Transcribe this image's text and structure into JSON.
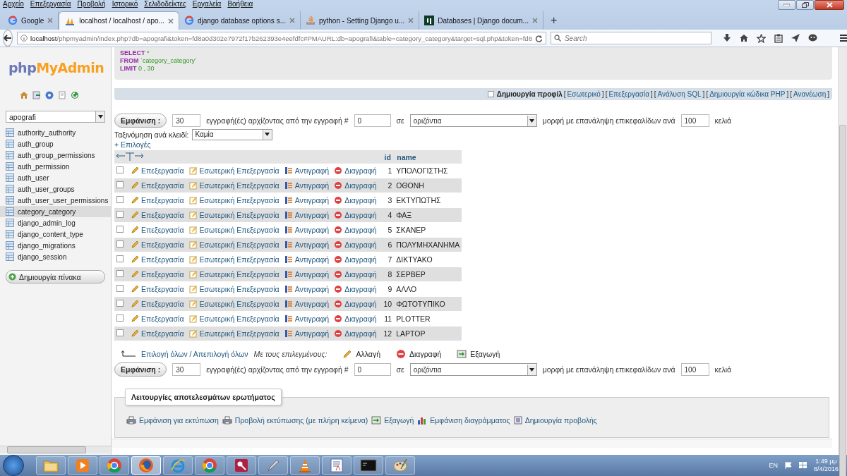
{
  "menu": [
    "Αρχείο",
    "Επεξεργασία",
    "Προβολή",
    "Ιστορικό",
    "Σελιδοδείκτες",
    "Εργαλεία",
    "Βοήθεια"
  ],
  "tabs": [
    {
      "kind": "google",
      "title": "Google",
      "selected": false
    },
    {
      "kind": "pma",
      "title": "localhost / localhost / apo...",
      "selected": true
    },
    {
      "kind": "google",
      "title": "django database options s...",
      "selected": false
    },
    {
      "kind": "so",
      "title": "python - Setting Django u...",
      "selected": false
    },
    {
      "kind": "dj",
      "title": "Databases | Django docum...",
      "selected": false
    }
  ],
  "new_tab": "+",
  "address": {
    "host": "localhost",
    "path": "/phpmyadmin/index.php?db=apografi&token=fd8a0d302e7972f17b262393e4eefdfc#PMAURL:db=apografi&table=category_category&target=sql.php&token=fd8"
  },
  "search": {
    "placeholder": "Search"
  },
  "sidebar": {
    "logo_a": "php",
    "logo_b": "MyAdmin",
    "database": "apografi",
    "tables": [
      {
        "name": "authority_authority",
        "selected": false
      },
      {
        "name": "auth_group",
        "selected": false
      },
      {
        "name": "auth_group_permissions",
        "selected": false
      },
      {
        "name": "auth_permission",
        "selected": false
      },
      {
        "name": "auth_user",
        "selected": false
      },
      {
        "name": "auth_user_groups",
        "selected": false
      },
      {
        "name": "auth_user_user_permissions",
        "selected": false
      },
      {
        "name": "category_category",
        "selected": true
      },
      {
        "name": "django_admin_log",
        "selected": false
      },
      {
        "name": "django_content_type",
        "selected": false
      },
      {
        "name": "django_migrations",
        "selected": false
      },
      {
        "name": "django_session",
        "selected": false
      }
    ],
    "create_button": "Δημιουργία πίνακα"
  },
  "sql": [
    {
      "keyword": "SELECT",
      "value": "*"
    },
    {
      "keyword": "FROM",
      "value": "`category_category`"
    },
    {
      "keyword": "LIMIT",
      "value": "0 , 30"
    }
  ],
  "profiling": {
    "checked": false,
    "label": "Δημιουργία προφίλ",
    "bracket_open": "[",
    "bracket_close": "]",
    "links": [
      "Εσωτερικό",
      "Επεξεργασία",
      "Ανάλυση SQL",
      "Δημιουργία κώδικα PHP",
      "Ανανέωση"
    ]
  },
  "navigators": [
    {
      "button": "Εμφάνιση :",
      "count": "30",
      "text_a": "εγγραφή(ές) αρχίζοντας από την εγγραφή #",
      "start": "0",
      "text_b": "σε",
      "mode": "οριζόντια",
      "text_c": "μορφή με επανάληψη επικεφαλίδων ανά",
      "repeat": "100",
      "text_d": "κελιά"
    },
    {
      "button": "Εμφάνιση :",
      "count": "30",
      "text_a": "εγγραφή(ές) αρχίζοντας από την εγγραφή #",
      "start": "0",
      "text_b": "σε",
      "mode": "οριζόντια",
      "text_c": "μορφή με επανάληψη επικεφαλίδων ανά",
      "repeat": "100",
      "text_d": "κελιά"
    }
  ],
  "sort": {
    "label": "Ταξινόμηση ανά κλειδί:",
    "value": "Καμία"
  },
  "options_link": "+ Επιλογές",
  "table": {
    "columns": [
      "id",
      "name"
    ],
    "rows": [
      {
        "checked": false,
        "actions": [
          "Επεξεργασία",
          "Εσωτερική Επεξεργασία",
          "Αντιγραφή",
          "Διαγραφή"
        ],
        "id": "1",
        "name": "ΥΠΟΛΟΓΙΣΤΗΣ"
      },
      {
        "checked": false,
        "actions": [
          "Επεξεργασία",
          "Εσωτερική Επεξεργασία",
          "Αντιγραφή",
          "Διαγραφή"
        ],
        "id": "2",
        "name": "ΟΘΟΝΗ"
      },
      {
        "checked": false,
        "actions": [
          "Επεξεργασία",
          "Εσωτερική Επεξεργασία",
          "Αντιγραφή",
          "Διαγραφή"
        ],
        "id": "3",
        "name": "ΕΚΤΥΠΩΤΗΣ"
      },
      {
        "checked": false,
        "actions": [
          "Επεξεργασία",
          "Εσωτερική Επεξεργασία",
          "Αντιγραφή",
          "Διαγραφή"
        ],
        "id": "4",
        "name": "ΦΑΞ"
      },
      {
        "checked": false,
        "actions": [
          "Επεξεργασία",
          "Εσωτερική Επεξεργασία",
          "Αντιγραφή",
          "Διαγραφή"
        ],
        "id": "5",
        "name": "ΣΚΑΝΕΡ"
      },
      {
        "checked": false,
        "actions": [
          "Επεξεργασία",
          "Εσωτερική Επεξεργασία",
          "Αντιγραφή",
          "Διαγραφή"
        ],
        "id": "6",
        "name": "ΠΟΛΥΜΗΧΑΝΗΜΑ"
      },
      {
        "checked": false,
        "actions": [
          "Επεξεργασία",
          "Εσωτερική Επεξεργασία",
          "Αντιγραφή",
          "Διαγραφή"
        ],
        "id": "7",
        "name": "ΔΙΚΤΥΑΚΟ"
      },
      {
        "checked": false,
        "actions": [
          "Επεξεργασία",
          "Εσωτερική Επεξεργασία",
          "Αντιγραφή",
          "Διαγραφή"
        ],
        "id": "8",
        "name": "ΣΕΡΒΕΡ"
      },
      {
        "checked": false,
        "actions": [
          "Επεξεργασία",
          "Εσωτερική Επεξεργασία",
          "Αντιγραφή",
          "Διαγραφή"
        ],
        "id": "9",
        "name": "ΑΛΛΟ"
      },
      {
        "checked": false,
        "actions": [
          "Επεξεργασία",
          "Εσωτερική Επεξεργασία",
          "Αντιγραφή",
          "Διαγραφή"
        ],
        "id": "10",
        "name": "ΦΩΤΟΤΥΠΙΚΟ"
      },
      {
        "checked": false,
        "actions": [
          "Επεξεργασία",
          "Εσωτερική Επεξεργασία",
          "Αντιγραφή",
          "Διαγραφή"
        ],
        "id": "11",
        "name": "PLOTTER"
      },
      {
        "checked": false,
        "actions": [
          "Επεξεργασία",
          "Εσωτερική Επεξεργασία",
          "Αντιγραφή",
          "Διαγραφή"
        ],
        "id": "12",
        "name": "LAPTOP"
      }
    ]
  },
  "bulk": {
    "select_all": "Επιλογή όλων / Απεπιλογή όλων",
    "with_selected": "Με τους επιλεγμένους:",
    "actions": [
      {
        "kind": "edit",
        "label": "Αλλαγή"
      },
      {
        "kind": "delete",
        "label": "Διαγραφή"
      },
      {
        "kind": "export",
        "label": "Εξαγωγή"
      }
    ]
  },
  "operations": {
    "legend": "Λειτουργίες αποτελεσμάτων ερωτήματος",
    "items": [
      {
        "kind": "print",
        "label": "Εμφάνιση για εκτύπωση"
      },
      {
        "kind": "print",
        "label": "Προβολή εκτύπωσης (με πλήρη κείμενα)"
      },
      {
        "kind": "export",
        "label": "Εξαγωγή"
      },
      {
        "kind": "chart",
        "label": "Εμφάνιση διαγράμματος"
      },
      {
        "kind": "view",
        "label": "Δημιουργία προβολής"
      }
    ]
  },
  "taskbar": {
    "apps": [
      {
        "kind": "folder",
        "selected": false
      },
      {
        "kind": "media",
        "selected": false
      },
      {
        "kind": "chrome",
        "selected": false
      },
      {
        "kind": "firefox",
        "selected": true
      },
      {
        "kind": "ie",
        "selected": false
      },
      {
        "kind": "chrome",
        "selected": false
      },
      {
        "kind": "key",
        "selected": false
      },
      {
        "kind": "pen",
        "selected": false
      },
      {
        "kind": "cone",
        "selected": false
      },
      {
        "kind": "doc",
        "selected": false
      },
      {
        "kind": "console",
        "selected": false
      },
      {
        "kind": "paint",
        "selected": false
      }
    ],
    "language": "EN",
    "time": "1:49 μμ",
    "date": "8/4/2016"
  }
}
